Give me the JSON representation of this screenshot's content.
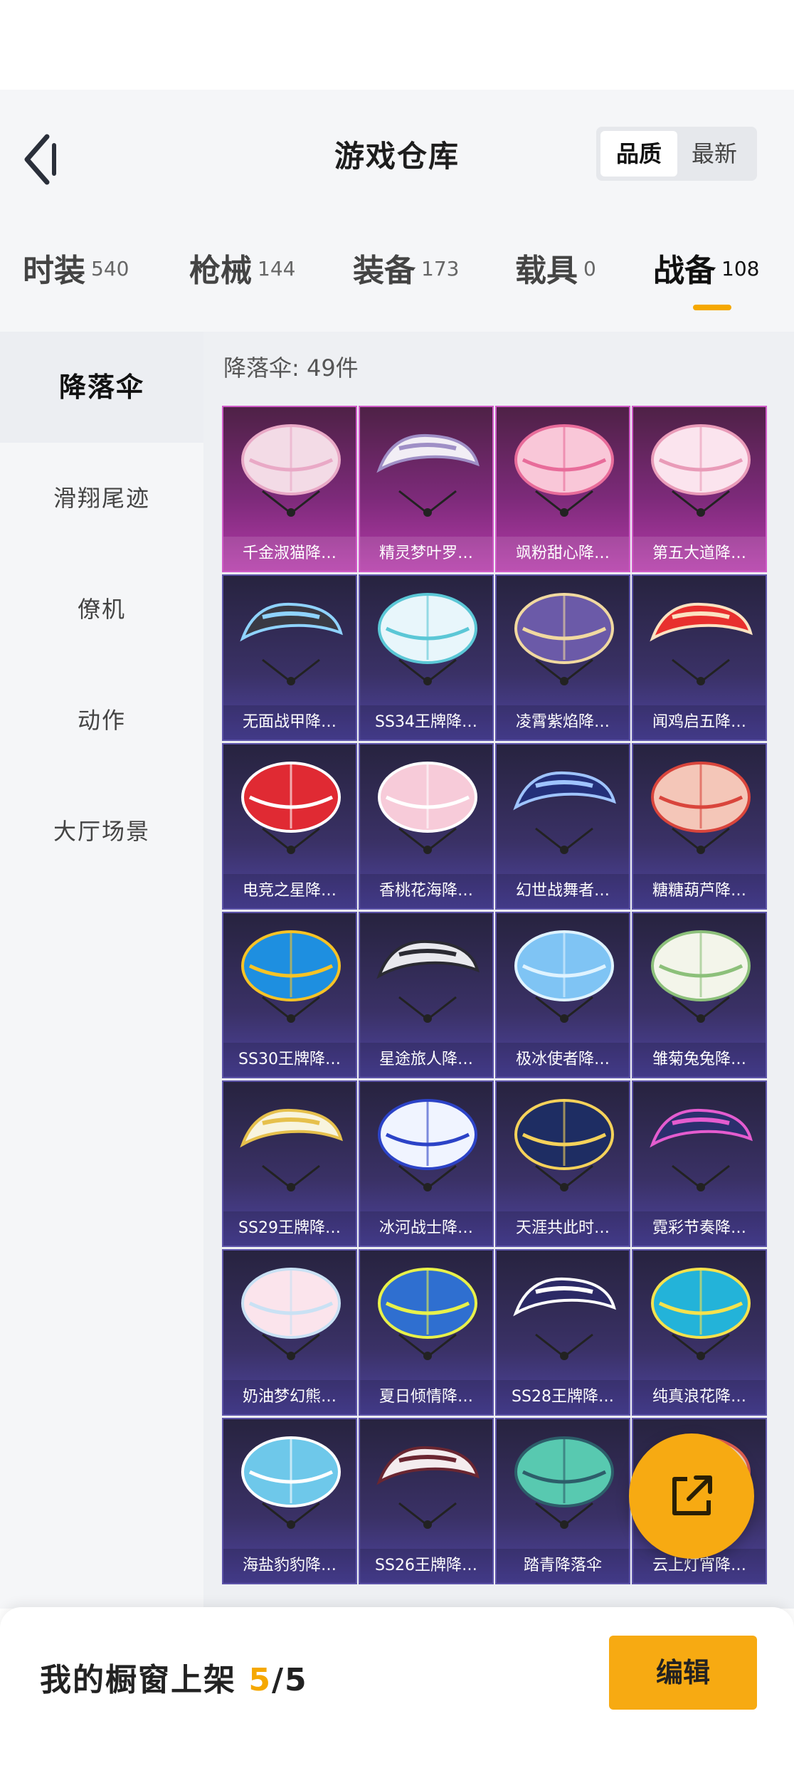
{
  "header": {
    "title": "游戏仓库",
    "sort": {
      "selected": "品质",
      "options": [
        "品质",
        "最新"
      ]
    }
  },
  "tabs": [
    {
      "label": "时装",
      "count": "540",
      "active": false
    },
    {
      "label": "枪械",
      "count": "144",
      "active": false
    },
    {
      "label": "装备",
      "count": "173",
      "active": false
    },
    {
      "label": "载具",
      "count": "0",
      "active": false
    },
    {
      "label": "战备",
      "count": "108",
      "active": true
    }
  ],
  "sidebar": {
    "items": [
      {
        "label": "降落伞",
        "active": true
      },
      {
        "label": "滑翔尾迹",
        "active": false
      },
      {
        "label": "僚机",
        "active": false
      },
      {
        "label": "动作",
        "active": false
      },
      {
        "label": "大厅场景",
        "active": false
      }
    ]
  },
  "content": {
    "count_label": "降落伞: 49件",
    "items": [
      {
        "name": "千金淑猫降…",
        "tier": "premium",
        "colors": [
          "#f3dbe6",
          "#e9a9c6"
        ]
      },
      {
        "name": "精灵梦叶罗…",
        "tier": "premium",
        "colors": [
          "#f2eef5",
          "#9f8fc6"
        ]
      },
      {
        "name": "飒粉甜心降…",
        "tier": "premium",
        "colors": [
          "#f9c7d8",
          "#e86c9a"
        ]
      },
      {
        "name": "第五大道降…",
        "tier": "premium",
        "colors": [
          "#fbe4ee",
          "#e99bb8"
        ]
      },
      {
        "name": "无面战甲降…",
        "tier": "normal",
        "colors": [
          "#3a3a44",
          "#8fd3ff"
        ]
      },
      {
        "name": "SS34王牌降…",
        "tier": "normal",
        "colors": [
          "#e8f6fb",
          "#5bc7d6"
        ]
      },
      {
        "name": "凌霄紫焰降…",
        "tier": "normal",
        "colors": [
          "#6b5aa8",
          "#f1d9a0"
        ]
      },
      {
        "name": "闻鸡启五降…",
        "tier": "normal",
        "colors": [
          "#e8302e",
          "#fbe3c2"
        ]
      },
      {
        "name": "电竞之星降…",
        "tier": "normal",
        "colors": [
          "#e02a33",
          "#ffffff"
        ]
      },
      {
        "name": "香桃花海降…",
        "tier": "normal",
        "colors": [
          "#f7cbd9",
          "#ffffff"
        ]
      },
      {
        "name": "幻世战舞者…",
        "tier": "normal",
        "colors": [
          "#24307a",
          "#9fc4ff"
        ]
      },
      {
        "name": "糖糖葫芦降…",
        "tier": "normal",
        "colors": [
          "#f4c6b8",
          "#d9453c"
        ]
      },
      {
        "name": "SS30王牌降…",
        "tier": "normal",
        "colors": [
          "#1e8fe0",
          "#f7c325"
        ]
      },
      {
        "name": "星途旅人降…",
        "tier": "normal",
        "colors": [
          "#e9e9ee",
          "#2b2b33"
        ]
      },
      {
        "name": "极冰使者降…",
        "tier": "normal",
        "colors": [
          "#7fc4f4",
          "#dff3ff"
        ]
      },
      {
        "name": "雏菊兔兔降…",
        "tier": "normal",
        "colors": [
          "#f3f5ea",
          "#8cc07a"
        ]
      },
      {
        "name": "SS29王牌降…",
        "tier": "normal",
        "colors": [
          "#f8f4de",
          "#e6c04c"
        ]
      },
      {
        "name": "冰河战士降…",
        "tier": "normal",
        "colors": [
          "#f0f4ff",
          "#2c43c7"
        ]
      },
      {
        "name": "天涯共此时…",
        "tier": "normal",
        "colors": [
          "#1e2d63",
          "#f5d25a"
        ]
      },
      {
        "name": "霓彩节奏降…",
        "tier": "normal",
        "colors": [
          "#2b2f6e",
          "#e45ccf"
        ]
      },
      {
        "name": "奶油梦幻熊…",
        "tier": "normal",
        "colors": [
          "#fbe4ec",
          "#c9e1f4"
        ]
      },
      {
        "name": "夏日倾情降…",
        "tier": "normal",
        "colors": [
          "#2f6fd0",
          "#e8f14a"
        ]
      },
      {
        "name": "SS28王牌降…",
        "tier": "normal",
        "colors": [
          "#2c2a66",
          "#ffffff"
        ]
      },
      {
        "name": "纯真浪花降…",
        "tier": "normal",
        "colors": [
          "#23b3d9",
          "#f5e24d"
        ]
      },
      {
        "name": "海盐豹豹降…",
        "tier": "normal",
        "colors": [
          "#6ec8ea",
          "#ffffff"
        ]
      },
      {
        "name": "SS26王牌降…",
        "tier": "normal",
        "colors": [
          "#f4ecee",
          "#6a2631"
        ]
      },
      {
        "name": "踏青降落伞",
        "tier": "normal",
        "colors": [
          "#58c9b0",
          "#2d5e6a"
        ]
      },
      {
        "name": "云上灯宵降…",
        "tier": "normal",
        "colors": [
          "#f2d9c0",
          "#e25f4f"
        ]
      }
    ]
  },
  "fab": {
    "icon": "share-external-icon"
  },
  "footer": {
    "showcase_label": "我的橱窗上架",
    "showcase_current": "5",
    "showcase_sep": "/",
    "showcase_total": "5",
    "edit_label": "编辑"
  },
  "colors": {
    "accent": "#f7aa12",
    "premium": "#9b2f93",
    "normal": "#3d3470"
  }
}
